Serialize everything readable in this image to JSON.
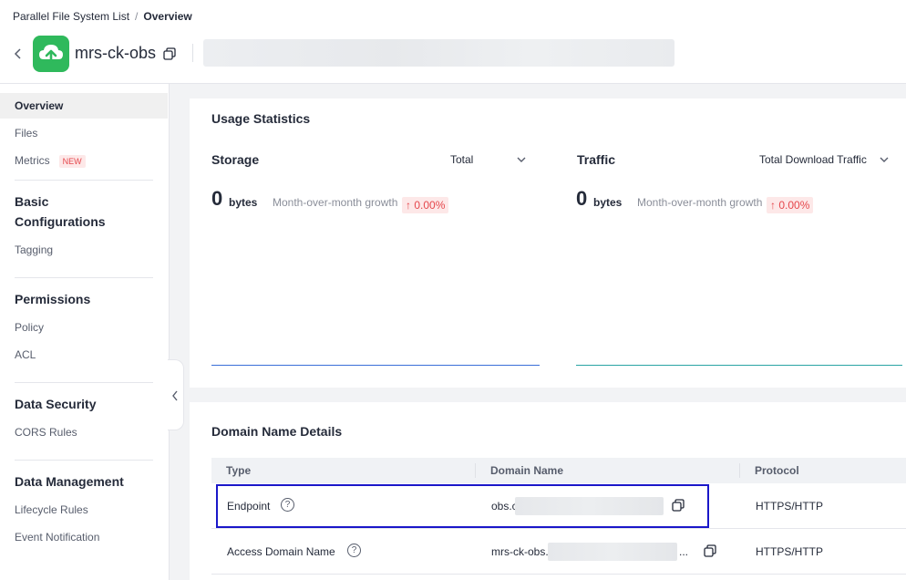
{
  "breadcrumb": {
    "parent": "Parallel File System List",
    "separator": "/",
    "current": "Overview"
  },
  "bucket": {
    "name": "mrs-ck-obs",
    "logo_color": "#2fb95c"
  },
  "sidebar": {
    "items": [
      {
        "label": "Overview",
        "active": true
      },
      {
        "label": "Files"
      },
      {
        "label": "Metrics",
        "badge": "NEW"
      }
    ],
    "sections": [
      {
        "title": "Basic Configurations",
        "items": [
          "Tagging"
        ]
      },
      {
        "title": "Permissions",
        "items": [
          "Policy",
          "ACL"
        ]
      },
      {
        "title": "Data Security",
        "items": [
          "CORS Rules"
        ]
      },
      {
        "title": "Data Management",
        "items": [
          "Lifecycle Rules",
          "Event Notification"
        ]
      }
    ]
  },
  "usage": {
    "title": "Usage Statistics",
    "storage": {
      "title": "Storage",
      "select": "Total",
      "value": "0",
      "unit": "bytes",
      "mom_label": "Month-over-month growth",
      "mom_value": "↑ 0.00%",
      "line_color": "#3a6fd8"
    },
    "traffic": {
      "title": "Traffic",
      "select": "Total Download Traffic",
      "value": "0",
      "unit": "bytes",
      "mom_label": "Month-over-month growth",
      "mom_value": "↑ 0.00%",
      "line_color": "#2aa3a3"
    }
  },
  "domain": {
    "title": "Domain Name Details",
    "columns": [
      "Type",
      "Domain Name",
      "Protocol"
    ],
    "rows": [
      {
        "type": "Endpoint",
        "domain_prefix": "obs.c",
        "protocol": "HTTPS/HTTP"
      },
      {
        "type": "Access Domain Name",
        "domain_prefix": "mrs-ck-obs.",
        "domain_suffix": "...",
        "protocol": "HTTPS/HTTP"
      }
    ]
  },
  "colors": {
    "accent": "#1a17c9",
    "badge_red": "#e5484d"
  }
}
